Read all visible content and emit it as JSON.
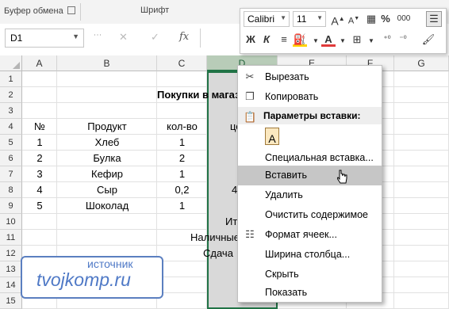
{
  "ribbon": {
    "clipboard_label": "Буфер обмена",
    "font_label": "Шрифт"
  },
  "formula_bar": {
    "cell_ref": "D1",
    "cancel": "✕",
    "enter": "✓",
    "fx": "fx",
    "value": ""
  },
  "columns": [
    "A",
    "B",
    "C",
    "D",
    "E",
    "F",
    "G"
  ],
  "rows": [
    "1",
    "2",
    "3",
    "4",
    "5",
    "6",
    "7",
    "8",
    "9",
    "10",
    "11",
    "12",
    "13",
    "14",
    "15"
  ],
  "sheet": {
    "title": "Покупки в магазине",
    "headers": {
      "num": "№",
      "product": "Продукт",
      "qty": "кол-во",
      "price": "цена"
    },
    "items": [
      {
        "num": "1",
        "product": "Хлеб",
        "qty": "1",
        "price": ""
      },
      {
        "num": "2",
        "product": "Булка",
        "qty": "2",
        "price": ""
      },
      {
        "num": "3",
        "product": "Кефир",
        "qty": "1",
        "price": ""
      },
      {
        "num": "4",
        "product": "Сыр",
        "qty": "0,2",
        "price": "4"
      },
      {
        "num": "5",
        "product": "Шоколад",
        "qty": "1",
        "price": ""
      }
    ],
    "total_label": "Итого",
    "cash_label": "Наличные",
    "change_label": "Сдача"
  },
  "mini_toolbar": {
    "font_name": "Calibri",
    "font_size": "11",
    "bold": "Ж",
    "italic": "К",
    "percent": "%",
    "thousands": "000",
    "font_color": "#e03a3a",
    "fill_color": "#ffd400"
  },
  "context_menu": {
    "cut": "Вырезать",
    "copy": "Копировать",
    "paste_options": "Параметры вставки:",
    "paste_special": "Специальная вставка...",
    "insert": "Вставить",
    "delete": "Удалить",
    "clear": "Очистить содержимое",
    "format_cells": "Формат ячеек...",
    "column_width": "Ширина столбца...",
    "hide": "Скрыть",
    "show": "Показать"
  },
  "watermark": {
    "line1": "источник",
    "line2": "tvojkomp.ru"
  },
  "colors": {
    "excel_green": "#217346",
    "selection_fill": "#d9d9d9",
    "watermark_blue": "#4f79c6"
  }
}
